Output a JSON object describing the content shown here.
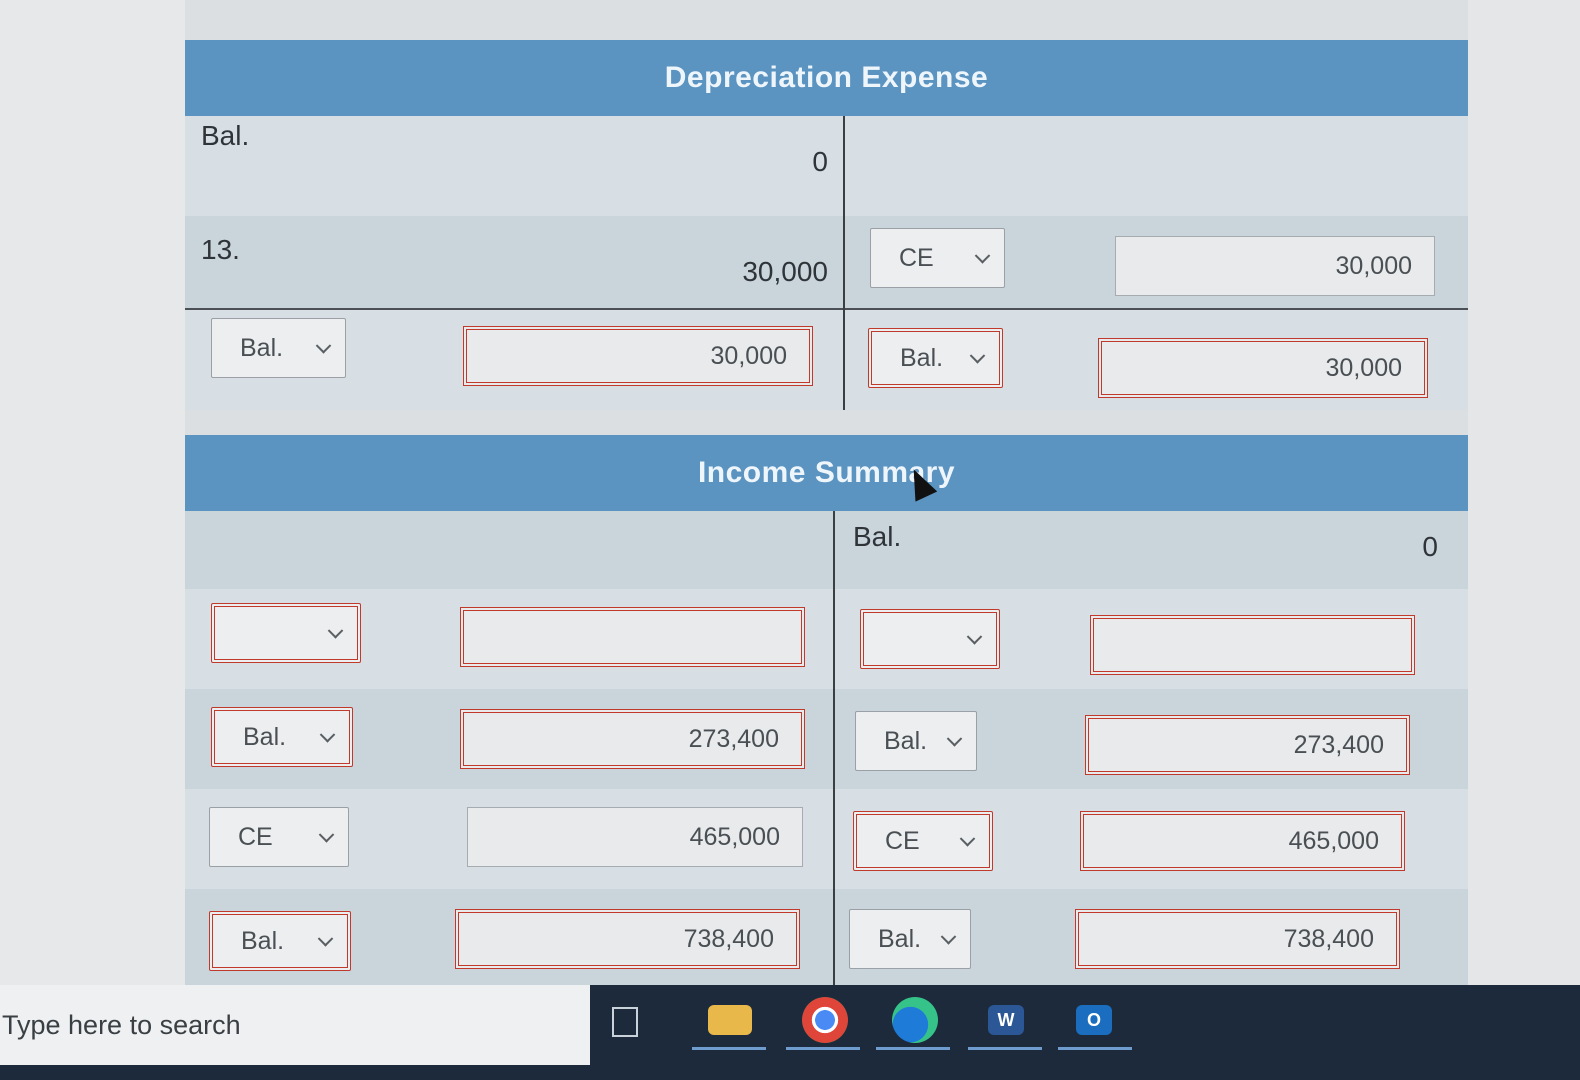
{
  "depreciation": {
    "title": "Depreciation Expense",
    "bal_label": "Bal.",
    "bal_value": "0",
    "entry_label": "13.",
    "entry_value": "30,000",
    "right_select": "CE",
    "right_value": "30,000",
    "total_select_left": "Bal.",
    "total_value_left": "30,000",
    "total_select_right": "Bal.",
    "total_value_right": "30,000"
  },
  "income_summary": {
    "title": "Income Summary",
    "bal_label": "Bal.",
    "bal_value": "0",
    "row1_select_left": "",
    "row1_value_left": "",
    "row1_select_right": "",
    "row1_value_right": "",
    "row2_select_left": "Bal.",
    "row2_value_left": "273,400",
    "row2_select_right": "Bal.",
    "row2_value_right": "273,400",
    "row3_select_left": "CE",
    "row3_value_left": "465,000",
    "row3_select_right": "CE",
    "row3_value_right": "465,000",
    "row4_select_left": "Bal.",
    "row4_value_left": "738,400",
    "row4_select_right": "Bal.",
    "row4_value_right": "738,400"
  },
  "taskbar": {
    "search_placeholder": "Type here to search",
    "icons": [
      "task-view-icon",
      "file-explorer-icon",
      "chrome-icon",
      "edge-icon",
      "word-icon",
      "outlook-icon"
    ]
  }
}
